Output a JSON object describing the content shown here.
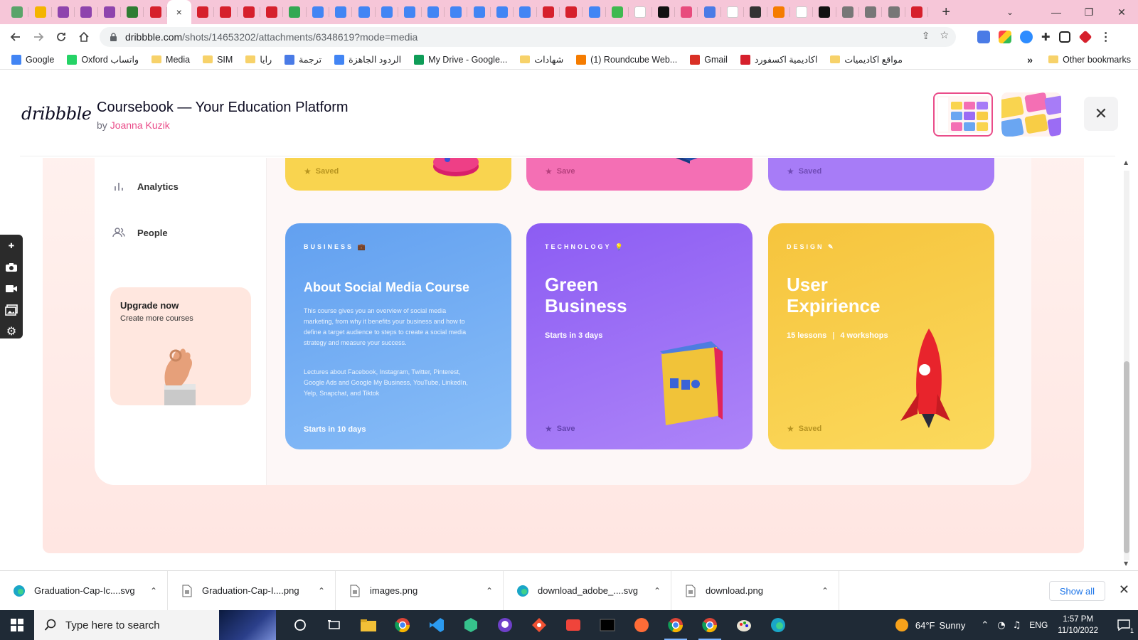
{
  "browser": {
    "active_tab_close": "×",
    "new_tab": "+",
    "window_controls": [
      "⌄",
      "—",
      "❐",
      "✕"
    ],
    "url_host": "dribbble.com",
    "url_path": "/shots/14653202/attachments/6348619?mode=media",
    "bookmarks": [
      {
        "label": "Google",
        "icon": "google-icon"
      },
      {
        "label": "Oxford واتساب",
        "icon": "whatsapp-icon"
      },
      {
        "label": "Media",
        "icon": "folder-icon"
      },
      {
        "label": "SIM",
        "icon": "folder-icon"
      },
      {
        "label": "رايا",
        "icon": "folder-icon"
      },
      {
        "label": "ترجمة",
        "icon": "translate-icon"
      },
      {
        "label": "الردود الجاهزة",
        "icon": "docs-icon"
      },
      {
        "label": "My Drive - Google...",
        "icon": "drive-icon"
      },
      {
        "label": "شهادات",
        "icon": "folder-icon"
      },
      {
        "label": "(1) Roundcube Web...",
        "icon": "roundcube-icon"
      },
      {
        "label": "Gmail",
        "icon": "gmail-icon"
      },
      {
        "label": "اكاديمية اكسفورد",
        "icon": "oxford-icon"
      },
      {
        "label": "مواقع اكاديميات",
        "icon": "folder-icon"
      }
    ],
    "bookmarks_more": "»",
    "other_bookmarks": "Other bookmarks"
  },
  "dribbble": {
    "logo": "dribbble",
    "shot_title": "Coursebook — Your Education Platform",
    "by_prefix": "by",
    "author": "Joanna Kuzik",
    "close": "✕"
  },
  "app": {
    "sidebar": {
      "items": [
        {
          "label": "Analytics",
          "icon": "analytics-icon"
        },
        {
          "label": "People",
          "icon": "people-icon"
        }
      ],
      "upgrade_title": "Upgrade now",
      "upgrade_subtitle": "Create more courses"
    },
    "top_cards": [
      {
        "save_label": "Saved",
        "color": "#f9d44f"
      },
      {
        "save_label": "Save",
        "color": "#f46fb4"
      },
      {
        "save_label": "Saved",
        "color": "#a77cf7"
      }
    ],
    "cards": [
      {
        "category": "BUSINESS 💼",
        "title": "About Social Media Course",
        "description": "This course gives you an overview of social media marketing, from why it benefits your business and how to define a target audience to steps to create a social media strategy and measure your success.",
        "lectures": "Lectures about Facebook, Instagram, Twitter, Pinterest, Google Ads and Google My Business, YouTube, LinkedIn, Yelp, Snapchat, and Tiktok",
        "meta": "Starts in 10 days",
        "color": "#6aa6f2"
      },
      {
        "category": "TECHNOLOGY 💡",
        "title": "Green Business",
        "meta": "Starts in 3 days",
        "save_label": "Save",
        "color": "#9b6cf4"
      },
      {
        "category": "DESIGN ✎",
        "title": "User Expirience",
        "meta_lessons": "15 lessons",
        "meta_workshops": "4 workshops",
        "save_label": "Saved",
        "color": "#f8cd45"
      }
    ]
  },
  "downloads": {
    "items": [
      {
        "name": "Graduation-Cap-Ic....svg",
        "icon": "edge-icon"
      },
      {
        "name": "Graduation-Cap-I....png",
        "icon": "file-icon"
      },
      {
        "name": "images.png",
        "icon": "file-icon"
      },
      {
        "name": "download_adobe_....svg",
        "icon": "edge-icon"
      },
      {
        "name": "download.png",
        "icon": "file-icon"
      }
    ],
    "show_all": "Show all",
    "close": "✕"
  },
  "taskbar": {
    "search_placeholder": "Type here to search",
    "weather_temp": "64°F",
    "weather_text": "Sunny",
    "language": "ENG",
    "time": "1:57 PM",
    "date": "11/10/2022",
    "notification_count": "1"
  }
}
